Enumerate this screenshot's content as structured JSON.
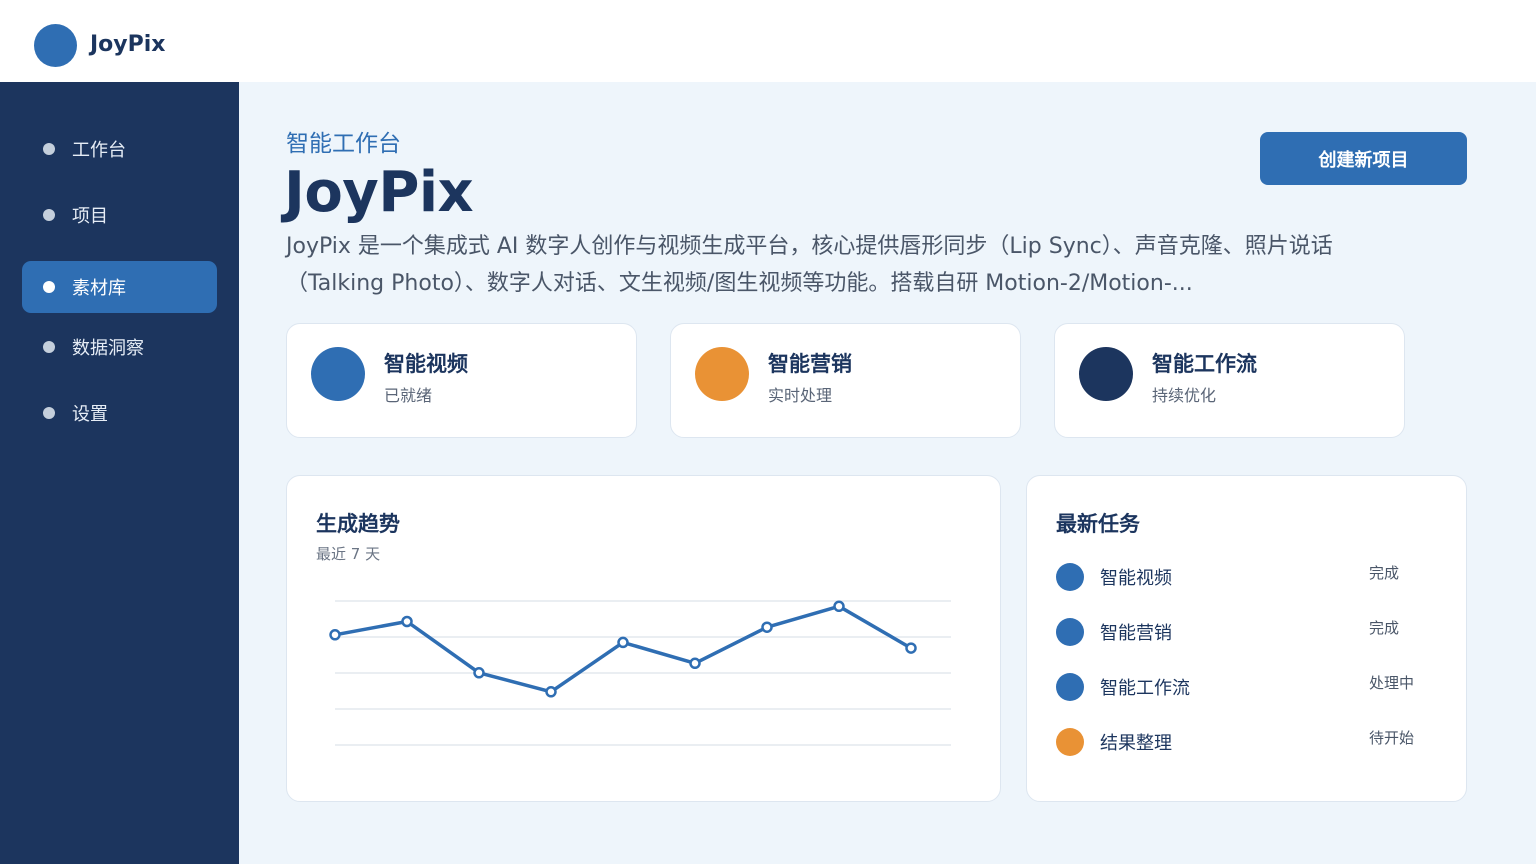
{
  "brand": {
    "name": "JoyPix",
    "color": "#2f6eb3"
  },
  "sidebar": {
    "items": [
      {
        "label": "工作台",
        "active": false
      },
      {
        "label": "项目",
        "active": false
      },
      {
        "label": "素材库",
        "active": true
      },
      {
        "label": "数据洞察",
        "active": false
      },
      {
        "label": "设置",
        "active": false
      }
    ]
  },
  "header": {
    "subtitle": "智能工作台",
    "title": "JoyPix",
    "description": "JoyPix 是一个集成式 AI 数字人创作与视频生成平台，核心提供唇形同步（Lip Sync）、声音克隆、照片说话（Talking Photo）、数字人对话、文生视频/图生视频等功能。搭载自研 Motion-2/Motion-...",
    "create_button": "创建新项目"
  },
  "stats": [
    {
      "title": "智能视频",
      "sub": "已就绪",
      "color": "#2f6eb3"
    },
    {
      "title": "智能营销",
      "sub": "实时处理",
      "color": "#e99235"
    },
    {
      "title": "智能工作流",
      "sub": "持续优化",
      "color": "#1c355e"
    }
  ],
  "trend": {
    "title": "生成趋势",
    "subtitle": "最近 7 天"
  },
  "chart_data": {
    "type": "line",
    "x": [
      1,
      2,
      3,
      4,
      5,
      6,
      7,
      8,
      9
    ],
    "values": [
      58,
      65,
      38,
      28,
      54,
      43,
      62,
      73,
      51
    ],
    "ylim": [
      0,
      100
    ],
    "grid": true,
    "color": "#2f6eb3"
  },
  "tasks": {
    "title": "最新任务",
    "items": [
      {
        "name": "智能视频",
        "status": "完成",
        "color": "#2f6eb3"
      },
      {
        "name": "智能营销",
        "status": "完成",
        "color": "#2f6eb3"
      },
      {
        "name": "智能工作流",
        "status": "处理中",
        "color": "#2f6eb3"
      },
      {
        "name": "结果整理",
        "status": "待开始",
        "color": "#e99235"
      }
    ]
  }
}
